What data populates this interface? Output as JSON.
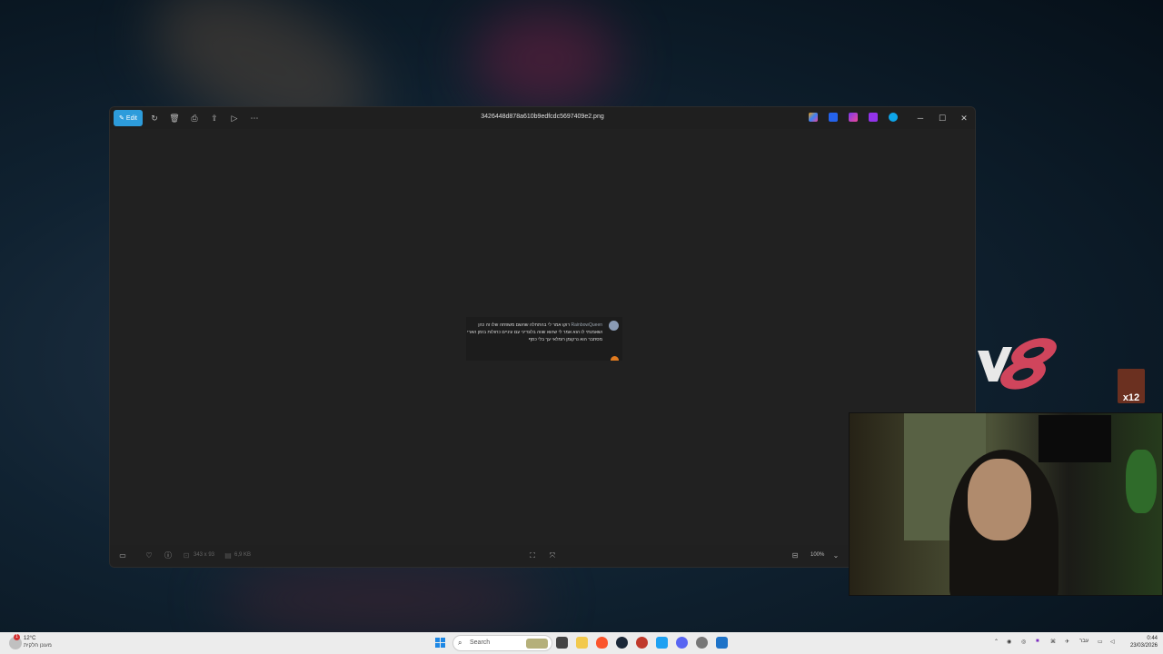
{
  "window": {
    "edit_label": "Edit",
    "title": "3426448d878a610b9edfcdc5697409e2.png",
    "toolbar_icons": [
      "rotate-icon",
      "delete-icon",
      "print-icon",
      "share-icon",
      "slideshow-icon",
      "more-icon"
    ],
    "app_icons": [
      "copilot-icon",
      "clipchamp-icon",
      "designer-icon",
      "photos-app-icon",
      "onedrive-icon"
    ]
  },
  "preview": {
    "username": "RainbowQueen",
    "message": "רוקו אמר לי בהתחלה שהשם משפחה שלו זה כהן ושאמנתי לו הוא אמר לי שהוא שווה בלונדיני עם עיניים כחולות בזמן הארי מסתבר הוא נרקומן רומלאי עך בלי כסף"
  },
  "statusbar": {
    "dimensions": "343 x 93",
    "filesize": "6,9 KB",
    "zoom": "100%"
  },
  "overlay": {
    "badge_text": "x12"
  },
  "taskbar": {
    "temperature": "12°C",
    "condition": "מעונן חלקית",
    "notification_count": "1",
    "search_placeholder": "Search",
    "language": "עבר",
    "time": "0:44",
    "date": "23/03/2026"
  }
}
